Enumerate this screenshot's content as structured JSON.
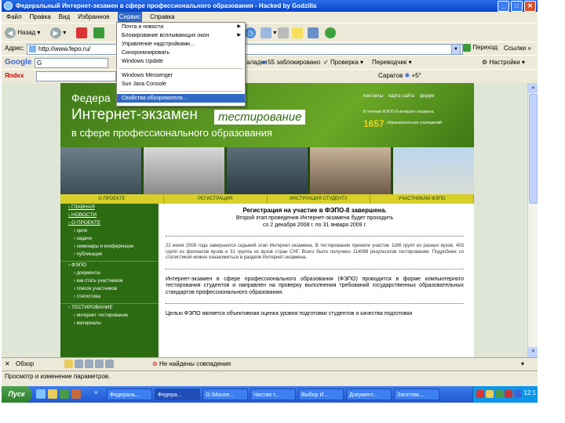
{
  "window": {
    "title": "Федеральный Интернет-экзамен в сфере профессионального образования - Hacked by Godzilla"
  },
  "menubar": [
    "Файл",
    "Правка",
    "Вид",
    "Избранное",
    "Сервис",
    "Справка"
  ],
  "navbar": {
    "back": "Назад",
    "forward": ""
  },
  "address": {
    "label": "Адрес:",
    "url": "http://www.fepo.ru/",
    "go": "Переход",
    "links": "Ссылки"
  },
  "google": {
    "logo": "Google",
    "g_label": "G",
    "blocked": "55 заблокировано",
    "check": "Проверка",
    "translate": "Переводчик",
    "settings": "Настройки",
    "tabs_text": "аладки"
  },
  "yandex": {
    "logo": "Яndex",
    "weather": "Саратов",
    "temp": "+5°"
  },
  "tools_menu": {
    "items": [
      "Почта и новости",
      "Блокирование всплывающих окон",
      "Управление надстройками...",
      "Синхронизировать",
      "Windows Update",
      "Windows Messenger",
      "Sun Java Console",
      "Свойства обозревателя..."
    ],
    "highlighted": "Свойства обозревателя..."
  },
  "site": {
    "header_line1": "Федера",
    "header_line2": "Интернет-экзамен",
    "header_tag": "тестирование",
    "header_line3": "в сфере профессионального образования",
    "top_links": [
      "контакты",
      "карта сайта",
      "форум"
    ],
    "stat_text1": "В течение ФЭПО-8 интернет-экзамена",
    "stat_number": "1657",
    "stat_text2": "образовательных учреждений",
    "tabs": [
      "О ПРОЕКТЕ",
      "РЕГИСТРАЦИЯ",
      "ИНСТРУКЦИЯ СТУДЕНТУ",
      "УЧАСТНИКАМ ФЭПО"
    ],
    "left_nav": [
      {
        "text": "ГЛАВНАЯ",
        "kind": "top"
      },
      {
        "text": "НОВОСТИ",
        "kind": "top"
      },
      {
        "text": "О ПРОЕКТЕ",
        "kind": "top"
      },
      {
        "text": "цели",
        "kind": "sub"
      },
      {
        "text": "задачи",
        "kind": "sub"
      },
      {
        "text": "семинары и конференции",
        "kind": "sub"
      },
      {
        "text": "публикации",
        "kind": "sub"
      },
      {
        "text": "ФЭПО",
        "kind": "hdr"
      },
      {
        "text": "документы",
        "kind": "sub"
      },
      {
        "text": "как стать участником",
        "kind": "sub"
      },
      {
        "text": "список участников",
        "kind": "sub"
      },
      {
        "text": "статистика",
        "kind": "sub"
      },
      {
        "text": "ТЕСТИРОВАНИЕ",
        "kind": "hdr"
      },
      {
        "text": "интернет-тестирование",
        "kind": "sub"
      },
      {
        "text": "материалы",
        "kind": "sub"
      }
    ],
    "main_title": "Регистрация на участие в ФЭПО-8 завершена.",
    "main_sub1": "Второй этап проведения Интернет-экзамена будет проходить",
    "main_sub2": "со 2 декабря 2008 г. по 31 января 2009 г.",
    "main_para1": "22 июня 2008 года завершился седьмой этап Интернет-экзамена. В тестировании приняли участие 1186 групп из разных вузов, 403 групп из филиалов вузов и 31 группа из вузов стран СНГ. Всего было получено 114088 результатов тестирования. Подробнее со статистикой можно ознакомиться в разделе Интернет-экзамена.",
    "main_para2": "Интернет-экзамен в сфере профессионального образования (ФЭПО) проводится в форме компьютерного тестирования студентов и направлен на проверку выполнения требований государственных образовательных стандартов профессионального образования.",
    "main_para3": "Целью ФЭПО является объективная оценка уровня подготовки студентов и качества подготовки"
  },
  "findbar": {
    "label": "Обзор",
    "blocked_msg": "Не найдены совпадения"
  },
  "statusbar": {
    "text": "Просмотр и изменение параметров."
  },
  "taskbar": {
    "start": "Пуск",
    "buttons": [
      "Федераль...",
      "Федера...",
      "G:\\Mouse...",
      "Чистая т...",
      "Выбор И...",
      "Документ...",
      "Заготовк..."
    ],
    "clock": "12:1"
  }
}
